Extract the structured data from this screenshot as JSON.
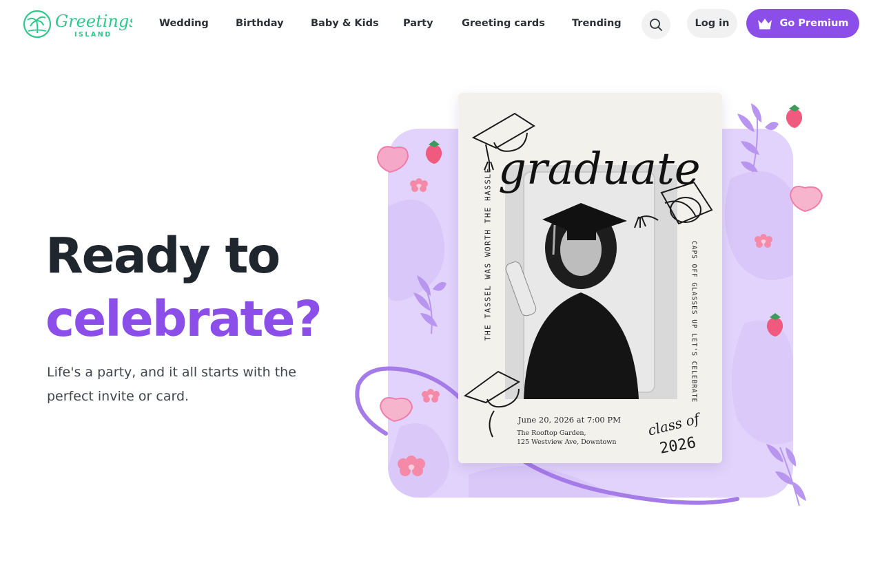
{
  "brand": {
    "name": "Greetings",
    "sub": "ISLAND",
    "color": "#2dc88a"
  },
  "nav": {
    "items": [
      {
        "label": "Wedding"
      },
      {
        "label": "Birthday"
      },
      {
        "label": "Baby & Kids"
      },
      {
        "label": "Party"
      },
      {
        "label": "Greeting cards"
      },
      {
        "label": "Trending"
      }
    ]
  },
  "header": {
    "search_icon": "search-icon",
    "login_label": "Log in",
    "premium_label": "Go Premium",
    "premium_icon": "crown-icon",
    "accent": "#8c4ee8"
  },
  "hero": {
    "title_line1": "Ready to",
    "title_line2": "celebrate?",
    "subtitle": "Life's a party, and it all starts with the perfect invite or card."
  },
  "card": {
    "headline": "graduate",
    "left_vertical": "THE TASSEL WAS WORTH THE HASSLE",
    "right_vertical": "CAPS OFF GLASSES UP LET'S CELEBRATE",
    "date": "June 20, 2026 at 7:00 PM",
    "venue_line1": "The Rooftop Garden,",
    "venue_line2": "125 Westview Ave, Downtown",
    "class_label": "class of",
    "class_year": "2026"
  }
}
